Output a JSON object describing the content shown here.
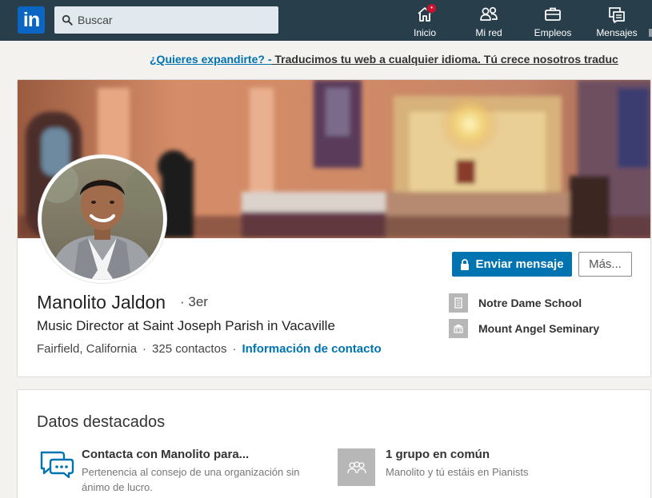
{
  "nav": {
    "logo_text": "in",
    "search_placeholder": "Buscar",
    "items": [
      {
        "label": "Inicio",
        "icon": "home-icon",
        "has_badge": true
      },
      {
        "label": "Mi red",
        "icon": "people-icon"
      },
      {
        "label": "Empleos",
        "icon": "briefcase-icon"
      },
      {
        "label": "Mensajes",
        "icon": "messages-icon"
      }
    ]
  },
  "promo": {
    "link_text": "¿Quieres expandirte? -",
    "text": " Traducimos tu web a cualquier idioma. Tú crece nosotros traduc"
  },
  "profile": {
    "name": "Manolito Jaldon",
    "degree": "· 3er",
    "headline": "Music Director at Saint Joseph Parish in Vacaville",
    "location": "Fairfield, California",
    "connections": "325 contactos",
    "separator": "·",
    "contact_info_label": "Información de contacto",
    "send_message_label": "Enviar mensaje",
    "more_label": "Más...",
    "education": [
      {
        "label": "Notre Dame School",
        "icon": "building-icon"
      },
      {
        "label": "Mount Angel Seminary",
        "icon": "school-icon"
      }
    ]
  },
  "highlights": {
    "title": "Datos destacados",
    "items": [
      {
        "heading": "Contacta con Manolito para...",
        "subtitle": "Pertenencia al consejo de una organización sin ánimo de lucro.",
        "icon": "chat-bubbles-icon"
      },
      {
        "heading": "1 grupo en común",
        "subtitle": "Manolito y tú estáis en Pianists",
        "icon": "group-icon"
      }
    ]
  },
  "colors": {
    "nav_bg": "#283e4a",
    "brand_blue": "#0073b1",
    "badge_red": "#cb112d",
    "page_bg": "#f3f2ef"
  }
}
